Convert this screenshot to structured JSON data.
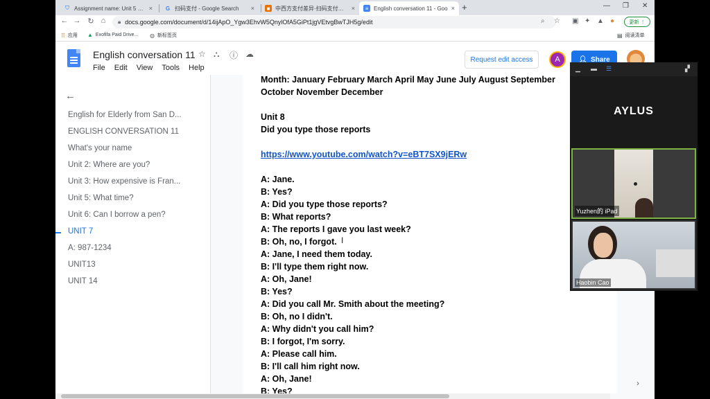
{
  "browser": {
    "tabs": [
      {
        "title": "Assignment name: Unit 5 Proj",
        "icon": "shield-icon"
      },
      {
        "title": "扫码支付 - Google Search",
        "icon": "google-icon"
      },
      {
        "title": "中西方支付差异·扫码支付与信用",
        "icon": "bookmark-icon"
      },
      {
        "title": "English conversation 11 - Goo",
        "icon": "docs-icon"
      }
    ],
    "url": "docs.google.com/document/d/14ijApO_Ygw3EhvW5QnylOfA5GiPt1jgVEtvgBwTJH5g/edit",
    "update_label": "更新",
    "bookmarks": [
      {
        "label": "应用",
        "icon": "apps-grid-icon"
      },
      {
        "label": "Exofifa Paid Drive...",
        "icon": "drive-icon"
      },
      {
        "label": "新标签页",
        "icon": "globe-icon"
      }
    ],
    "reading_list": "阅读清单"
  },
  "docs": {
    "title": "English conversation 11",
    "menu": [
      "File",
      "Edit",
      "View",
      "Tools",
      "Help"
    ],
    "request_access": "Request edit access",
    "avatar_letter": "A",
    "share_label": "Share",
    "outline": [
      {
        "label": "English for Elderly from San D...",
        "active": false
      },
      {
        "label": "ENGLISH CONVERSATION 11",
        "active": false
      },
      {
        "label": "What's your name",
        "active": false
      },
      {
        "label": "Unit 2: Where are you?",
        "active": false
      },
      {
        "label": "Unit 3: How expensive is Fran...",
        "active": false
      },
      {
        "label": "Unit 5: What time?",
        "active": false
      },
      {
        "label": "Unit 6: Can I borrow a pen?",
        "active": false
      },
      {
        "label": "UNIT 7",
        "active": true
      },
      {
        "label": "A: 987-1234",
        "active": false
      },
      {
        "label": "UNIT13",
        "active": false
      },
      {
        "label": "UNIT 14",
        "active": false
      }
    ],
    "lines": [
      {
        "text": "Month: January February March April May June July August September",
        "link": false
      },
      {
        "text": "October November December",
        "link": false
      },
      {
        "text": "",
        "link": false
      },
      {
        "text": "Unit 8",
        "link": false
      },
      {
        "text": "Did you type those reports",
        "link": false
      },
      {
        "text": "",
        "link": false
      },
      {
        "text": "https://www.youtube.com/watch?v=eBT7SX9jERw",
        "link": true
      },
      {
        "text": "",
        "link": false
      },
      {
        "text": "A: Jane.",
        "link": false
      },
      {
        "text": "B: Yes?",
        "link": false
      },
      {
        "text": "A: Did you type those reports?",
        "link": false
      },
      {
        "text": "B: What reports?",
        "link": false
      },
      {
        "text": "A: The reports I gave you last week?",
        "link": false
      },
      {
        "text": "B: Oh, no, I forgot.",
        "link": false
      },
      {
        "text": "A: Jane, I need them today.",
        "link": false
      },
      {
        "text": "B: I'll type them right now.",
        "link": false
      },
      {
        "text": "A: Oh, Jane!",
        "link": false
      },
      {
        "text": "B: Yes?",
        "link": false
      },
      {
        "text": "A: Did you call Mr. Smith about the meeting?",
        "link": false
      },
      {
        "text": "B: Oh, no I didn't.",
        "link": false
      },
      {
        "text": "A: Why didn't you call him?",
        "link": false
      },
      {
        "text": "B: I forgot, I'm sorry.",
        "link": false
      },
      {
        "text": "A: Please call him.",
        "link": false
      },
      {
        "text": "B: I'll call him right now.",
        "link": false
      },
      {
        "text": "A: Oh, Jane!",
        "link": false
      },
      {
        "text": "B: Yes?",
        "link": false
      }
    ]
  },
  "zoom": {
    "host_name": "AYLUS",
    "participants": [
      {
        "label": "Yuzhen的 iPad"
      },
      {
        "label": "Haobin Cao"
      }
    ]
  },
  "colors": {
    "accent": "#1a73e8",
    "link": "#1155cc",
    "share": "#1a73e8",
    "tile_border": "#7cb342"
  }
}
